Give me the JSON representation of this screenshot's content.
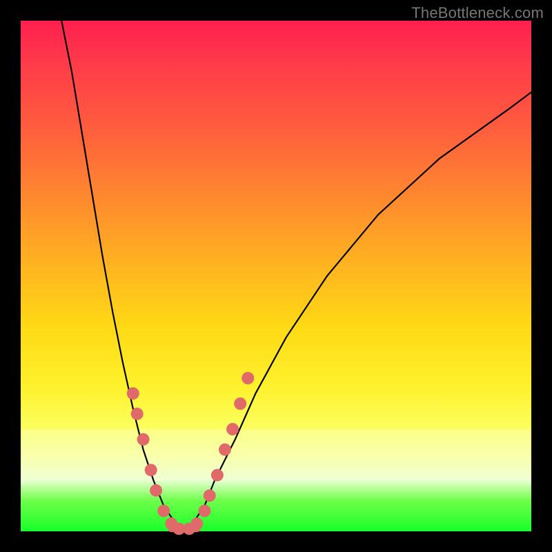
{
  "watermark": "TheBottleneck.com",
  "colors": {
    "dot": "#e06a6a",
    "curve": "#000000",
    "background_black": "#000000"
  },
  "chart_data": {
    "type": "line",
    "title": "",
    "xlabel": "",
    "ylabel": "",
    "xlim": [
      0,
      100
    ],
    "ylim": [
      0,
      100
    ],
    "series": [
      {
        "name": "left-branch",
        "x": [
          8,
          10,
          12,
          14,
          16,
          18,
          20,
          22,
          24,
          26,
          28,
          30,
          32
        ],
        "y": [
          100,
          90,
          78,
          66,
          54,
          43,
          33,
          24,
          16,
          10,
          5,
          2,
          0
        ]
      },
      {
        "name": "right-branch",
        "x": [
          32,
          34,
          36,
          38,
          42,
          46,
          52,
          60,
          70,
          82,
          96,
          100
        ],
        "y": [
          0,
          2,
          5,
          10,
          18,
          27,
          38,
          50,
          62,
          73,
          83,
          86
        ]
      }
    ],
    "markers": {
      "name": "salmon-dots",
      "points": [
        {
          "x": 22.0,
          "y": 27
        },
        {
          "x": 22.8,
          "y": 23
        },
        {
          "x": 24.0,
          "y": 18
        },
        {
          "x": 25.5,
          "y": 12
        },
        {
          "x": 26.5,
          "y": 8
        },
        {
          "x": 28.0,
          "y": 4
        },
        {
          "x": 29.5,
          "y": 1.5
        },
        {
          "x": 31.0,
          "y": 0.5
        },
        {
          "x": 33.0,
          "y": 0.5
        },
        {
          "x": 34.5,
          "y": 1.5
        },
        {
          "x": 36.0,
          "y": 4
        },
        {
          "x": 37.0,
          "y": 7
        },
        {
          "x": 38.5,
          "y": 11
        },
        {
          "x": 40.0,
          "y": 16
        },
        {
          "x": 41.5,
          "y": 20
        },
        {
          "x": 43.0,
          "y": 25
        },
        {
          "x": 44.5,
          "y": 30
        }
      ]
    },
    "bottom_segment": {
      "x0": 29.5,
      "x1": 34.5,
      "y": 0.5
    }
  }
}
